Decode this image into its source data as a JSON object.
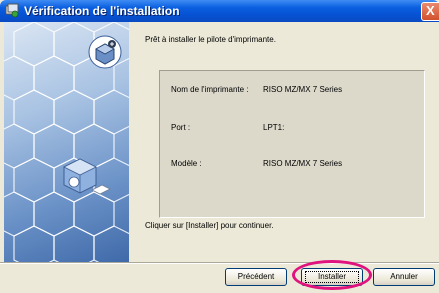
{
  "window": {
    "title": "Vérification de l'installation",
    "icon": "setup-icon",
    "close_label": "X"
  },
  "banner": {
    "decoration": "hexagon-pattern",
    "icons": [
      "printer-icon",
      "cube-icon"
    ]
  },
  "content": {
    "intro": "Prêt à installer le pilote d'imprimante.",
    "details": [
      {
        "label": "Nom de l'imprimante :",
        "value": "RISO MZ/MX 7 Series"
      },
      {
        "label": "Port :",
        "value": "LPT1:"
      },
      {
        "label": "Modèle :",
        "value": "RISO MZ/MX 7 Series"
      }
    ],
    "footer": "Cliquer sur [Installer] pour continuer."
  },
  "buttons": {
    "previous": "Précédent",
    "install": "Installer",
    "cancel": "Annuler"
  },
  "colors": {
    "titlebar": "#0a5fe0",
    "highlight": "#e0137e",
    "window_bg": "#ece9d8"
  }
}
